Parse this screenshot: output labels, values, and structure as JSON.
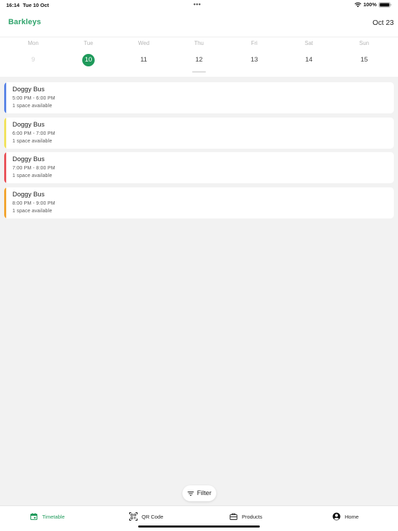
{
  "status_bar": {
    "time": "16:14",
    "date": "Tue 10 Oct",
    "dots": "•••",
    "battery": "100%"
  },
  "header": {
    "logo": "Barkleys",
    "month": "Oct 23"
  },
  "week": {
    "days": [
      {
        "name": "Mon",
        "num": "9",
        "state": "muted"
      },
      {
        "name": "Tue",
        "num": "10",
        "state": "selected"
      },
      {
        "name": "Wed",
        "num": "11",
        "state": "normal"
      },
      {
        "name": "Thu",
        "num": "12",
        "state": "normal"
      },
      {
        "name": "Fri",
        "num": "13",
        "state": "normal"
      },
      {
        "name": "Sat",
        "num": "14",
        "state": "normal"
      },
      {
        "name": "Sun",
        "num": "15",
        "state": "normal"
      }
    ]
  },
  "sessions": [
    {
      "title": "Doggy Bus",
      "time": "5:00 PM - 6:00 PM",
      "spaces": "1 space available",
      "accent": "#5b85e6"
    },
    {
      "title": "Doggy Bus",
      "time": "6:00 PM - 7:00 PM",
      "spaces": "1 space available",
      "accent": "#f1e25c"
    },
    {
      "title": "Doggy Bus",
      "time": "7:00 PM - 8:00 PM",
      "spaces": "1 space available",
      "accent": "#e9535a"
    },
    {
      "title": "Doggy Bus",
      "time": "8:00 PM - 9:00 PM",
      "spaces": "1 space available",
      "accent": "#f2a531"
    }
  ],
  "filter": {
    "label": "Filter",
    "icon": "filter-icon"
  },
  "tabs": [
    {
      "label": "Timetable",
      "icon": "calendar-icon",
      "active": true
    },
    {
      "label": "QR Code",
      "icon": "qr-code-icon",
      "active": false
    },
    {
      "label": "Products",
      "icon": "briefcase-icon",
      "active": false
    },
    {
      "label": "Home",
      "icon": "user-circle-icon",
      "active": false
    }
  ],
  "colors": {
    "brand": "#1f9a5b",
    "logo": "#2fa36b",
    "background": "#f2f2f2"
  }
}
